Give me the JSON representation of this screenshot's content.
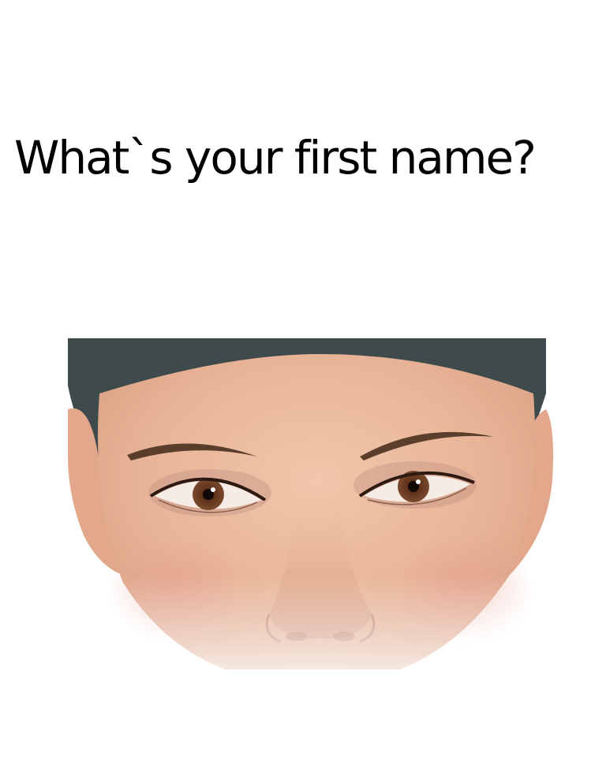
{
  "question": {
    "text": "What`s your first name?"
  },
  "photo": {
    "subject": "face-closeup-eyes-and-nose",
    "colors": {
      "skin": "#eab99c",
      "skin_shadow": "#d49c7f",
      "hair": "#3f4a4c",
      "iris": "#6a3a22",
      "brow": "#5b3d2c",
      "background": "#ffffff"
    }
  }
}
